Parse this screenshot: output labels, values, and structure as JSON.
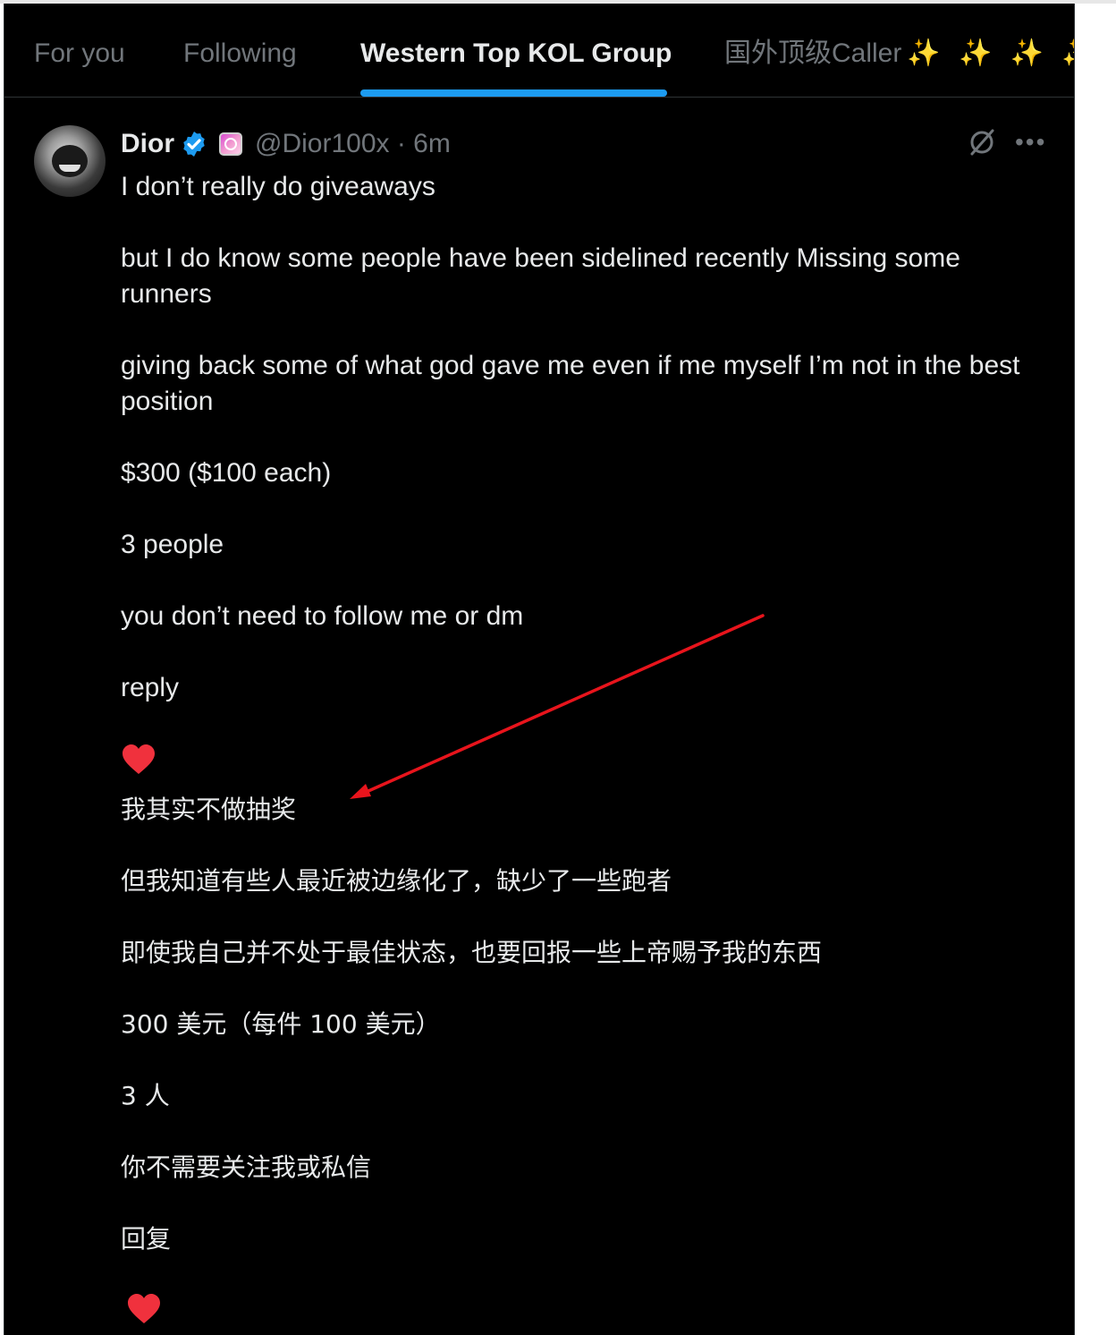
{
  "tabs": [
    {
      "label": "For you",
      "active": false
    },
    {
      "label": "Following",
      "active": false
    },
    {
      "label": "Western Top KOL Group",
      "active": true
    },
    {
      "label": "国外顶级Caller",
      "active": false,
      "suffix": "✨ ✨ ✨ ✨"
    }
  ],
  "tweet": {
    "author_name": "Dior",
    "handle_time": "@Dior100x · 6m",
    "verified": true,
    "lines_en": {
      "l1": "I don’t really do giveaways",
      "l2": "but I do know some people have been sidelined recently Missing some runners",
      "l3": "giving back some of what god gave me even if me myself I’m not in the best position",
      "l4": "$300 ($100 each)",
      "l5": "3 people",
      "l6": "you don’t need to follow me or dm",
      "l7": "reply"
    },
    "lines_cn": {
      "l1": "我其实不做抽奖",
      "l2": "但我知道有些人最近被边缘化了，缺少了一些跑者",
      "l3": "即使我自己并不处于最佳状态，也要回报一些上帝赐予我的东西",
      "l4": "300 美元（每件 100 美元）",
      "l5": "3 人",
      "l6": "你不需要关注我或私信",
      "l7": "回复"
    }
  },
  "icons": {
    "verified": "verified-badge-icon",
    "affiliate": "affiliate-badge-icon",
    "grok": "grok-icon",
    "more": "more-icon",
    "heart": "heart-icon"
  },
  "colors": {
    "accent": "#1d9bf0",
    "background": "#000000",
    "text": "#e7e9ea",
    "muted": "#71767b",
    "heart": "#f0313d",
    "annotation_arrow": "#e8141c"
  }
}
